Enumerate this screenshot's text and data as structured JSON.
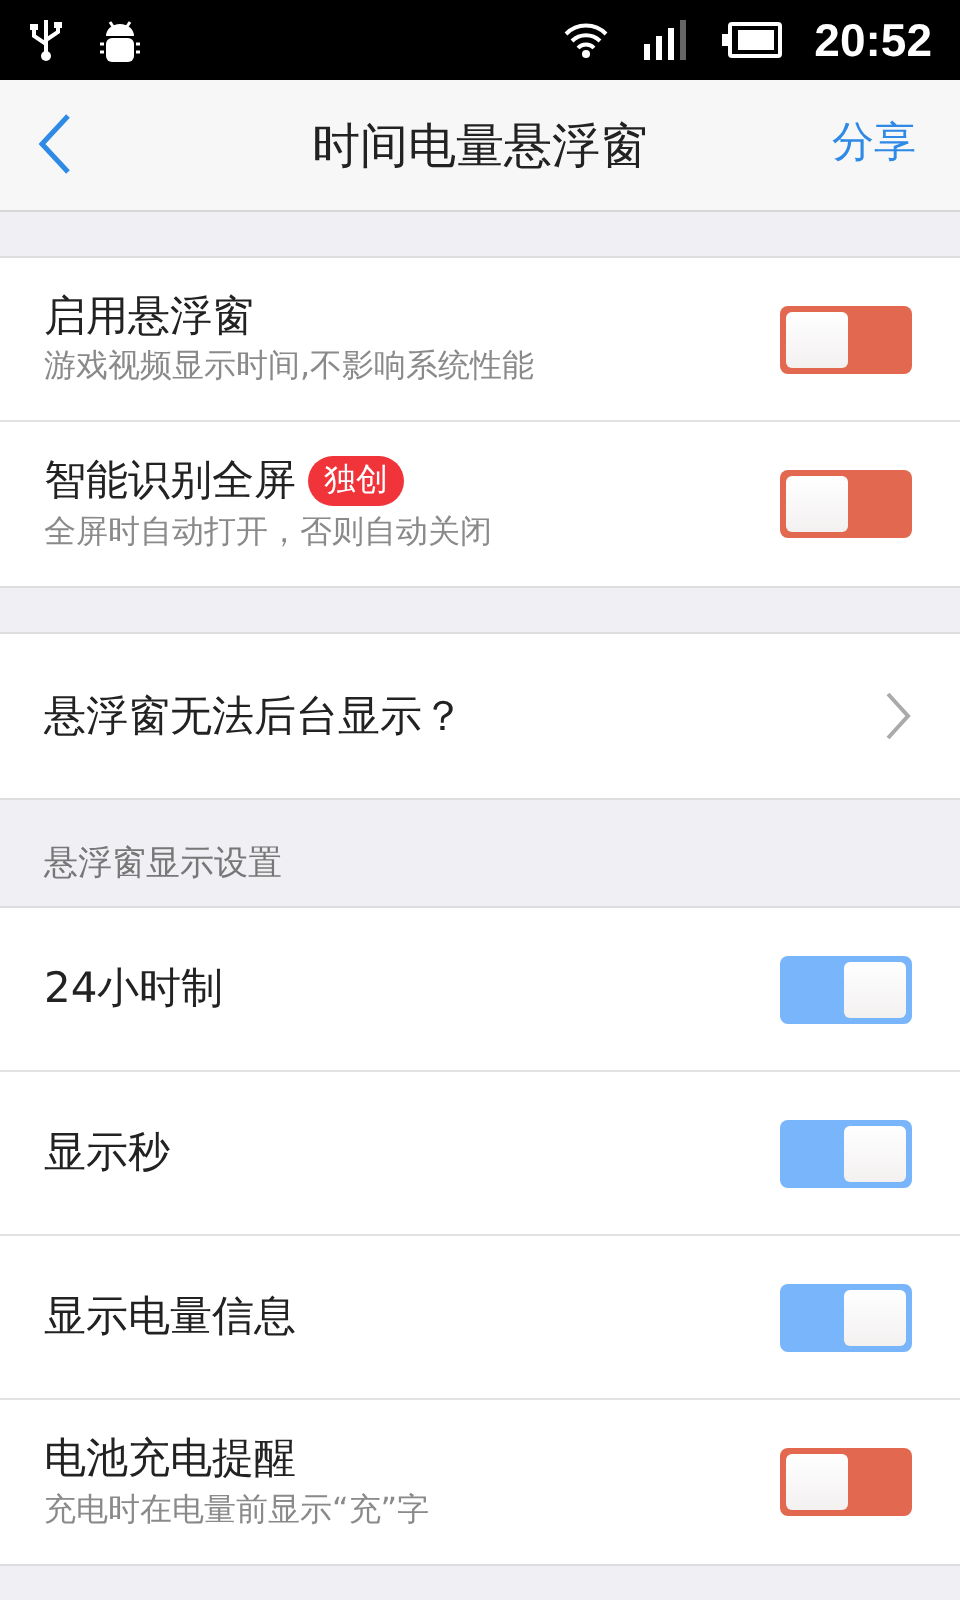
{
  "status_bar": {
    "time": "20:52"
  },
  "header": {
    "title": "时间电量悬浮窗",
    "action": "分享"
  },
  "groups": [
    {
      "items": [
        {
          "kind": "toggle",
          "title": "启用悬浮窗",
          "subtitle": "游戏视频显示时间,不影响系统性能",
          "on": false
        },
        {
          "kind": "toggle",
          "title": "智能识别全屏",
          "badge": "独创",
          "subtitle": "全屏时自动打开，否则自动关闭",
          "on": false
        }
      ]
    },
    {
      "items": [
        {
          "kind": "link",
          "title": "悬浮窗无法后台显示？"
        }
      ]
    },
    {
      "heading": "悬浮窗显示设置",
      "items": [
        {
          "kind": "toggle",
          "title": "24小时制",
          "on": true
        },
        {
          "kind": "toggle",
          "title": "显示秒",
          "on": true
        },
        {
          "kind": "toggle",
          "title": "显示电量信息",
          "on": true
        },
        {
          "kind": "toggle",
          "title": "电池充电提醒",
          "subtitle": "充电时在电量前显示“充”字",
          "on": false
        }
      ]
    }
  ]
}
